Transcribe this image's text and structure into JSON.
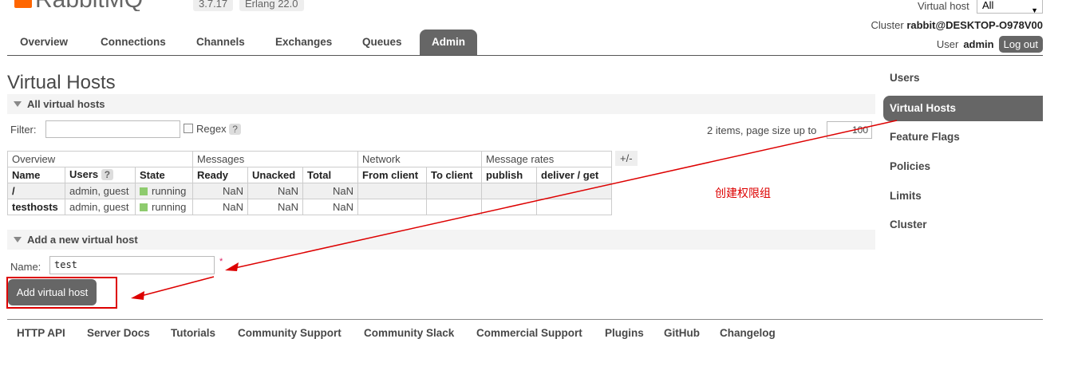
{
  "header": {
    "logo_text": "RabbitMQ",
    "version": "3.7.17",
    "erlang": "Erlang 22.0",
    "virtual_host_label": "Virtual host",
    "virtual_host_value": "All",
    "cluster_label": "Cluster",
    "cluster_name": "rabbit@DESKTOP-O978V00",
    "user_label": "User",
    "user_name": "admin",
    "logout_label": "Log out"
  },
  "tabs": [
    "Overview",
    "Connections",
    "Channels",
    "Exchanges",
    "Queues",
    "Admin"
  ],
  "active_tab": "Admin",
  "page_title": "Virtual Hosts",
  "all_vhosts": {
    "section_title": "All virtual hosts",
    "filter_label": "Filter:",
    "filter_value": "",
    "regex_label": "Regex",
    "help_mark": "?",
    "items_text": "2 items, page size up to",
    "page_size": "100",
    "plus_minus": "+/-",
    "group_headers": [
      "Overview",
      "Messages",
      "Network",
      "Message rates"
    ],
    "columns": [
      "Name",
      "Users",
      "State",
      "Ready",
      "Unacked",
      "Total",
      "From client",
      "To client",
      "publish",
      "deliver / get"
    ],
    "rows": [
      {
        "name": "/",
        "users": "admin, guest",
        "state": "running",
        "ready": "NaN",
        "unacked": "NaN",
        "total": "NaN"
      },
      {
        "name": "testhosts",
        "users": "admin, guest",
        "state": "running",
        "ready": "NaN",
        "unacked": "NaN",
        "total": "NaN"
      }
    ]
  },
  "add_vhost": {
    "section_title": "Add a new virtual host",
    "name_label": "Name:",
    "name_value": "test",
    "required_mark": "*",
    "button_label": "Add virtual host"
  },
  "sidebar": [
    "Users",
    "Virtual Hosts",
    "Feature Flags",
    "Policies",
    "Limits",
    "Cluster"
  ],
  "sidebar_active": "Virtual Hosts",
  "annotation": "创建权限组",
  "footer": [
    "HTTP API",
    "Server Docs",
    "Tutorials",
    "Community Support",
    "Community Slack",
    "Commercial Support",
    "Plugins",
    "GitHub",
    "Changelog"
  ],
  "colors": {
    "accent": "#666666",
    "annotation": "#dd0000",
    "running": "#8ecb6e",
    "brand": "#ff6600"
  }
}
